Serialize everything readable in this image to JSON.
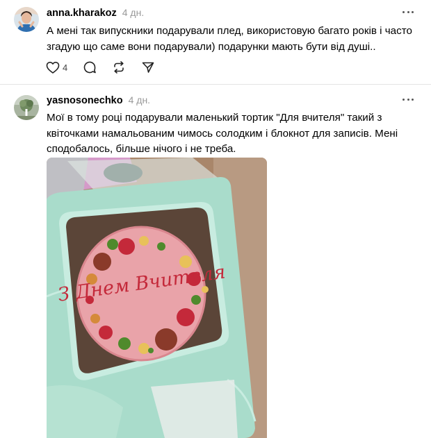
{
  "posts": [
    {
      "username": "anna.kharakoz",
      "time": "4 дн.",
      "text": "А мені так випускники подарували плед, використовую багато років і часто згадую що саме вони подарували) подарунки мають бути від душі..",
      "likes": "4",
      "icons": [
        "heart-icon",
        "comment-icon",
        "repost-icon",
        "share-icon",
        "more-icon"
      ]
    },
    {
      "username": "yasnosonechko",
      "time": "4 дн.",
      "text": "Мої в тому році подарували маленький тортик \"Для вчителя\" такий з квіточками намальованим чимось солодким і блокнот для записів. Мені сподобалось, більше нічого і не треба.",
      "cake_text": "З Днем Вчителя",
      "icons": [
        "more-icon"
      ]
    }
  ],
  "colors": {
    "text": "#000000",
    "muted": "#999999",
    "divider": "#e3e3e3",
    "box_mint": "#a9dccb",
    "cake_pink": "#e9a3a9",
    "icing_red": "#c4293a"
  }
}
